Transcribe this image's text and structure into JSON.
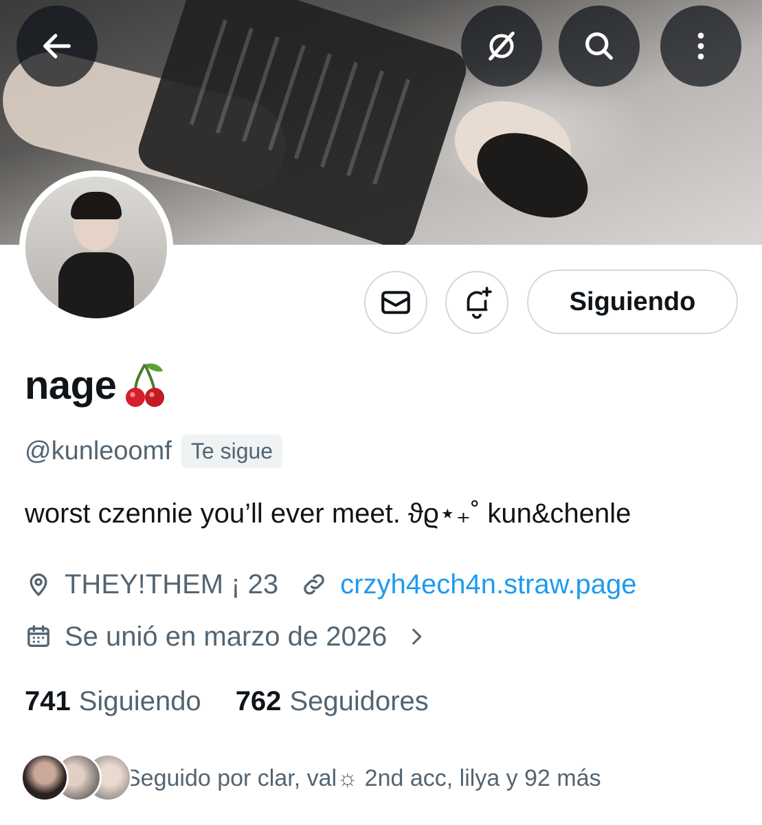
{
  "profile": {
    "display_name": "nage",
    "handle": "@kunleoomf",
    "follows_you_badge": "Te sigue",
    "bio": "worst czennie you’ll ever meet. ϑϱ⋆₊˚ kun&chenle",
    "location": "THEY!THEM ¡ 23",
    "website": "crzyh4ech4n.straw.page",
    "joined": "Se unió en marzo de 2026"
  },
  "actions": {
    "follow_state_label": "Siguiendo"
  },
  "stats": {
    "following_count": "741",
    "following_label": "Siguiendo",
    "followers_count": "762",
    "followers_label": "Seguidores"
  },
  "followed_by": {
    "text": "Seguido por clar, val☼ 2nd acc, lilya y 92 más"
  },
  "icons": {
    "back": "arrow-left-icon",
    "grok": "grok-icon",
    "search": "search-icon",
    "more": "more-vertical-icon",
    "message": "envelope-icon",
    "notify": "bell-plus-icon",
    "location": "location-pin-icon",
    "link": "link-icon",
    "calendar": "calendar-icon",
    "chevron": "chevron-right-icon",
    "name_emoji": "cherry-icon"
  },
  "colors": {
    "text_primary": "#0f1419",
    "text_secondary": "#536471",
    "link": "#1d9bf0",
    "border": "#cfd9de"
  }
}
